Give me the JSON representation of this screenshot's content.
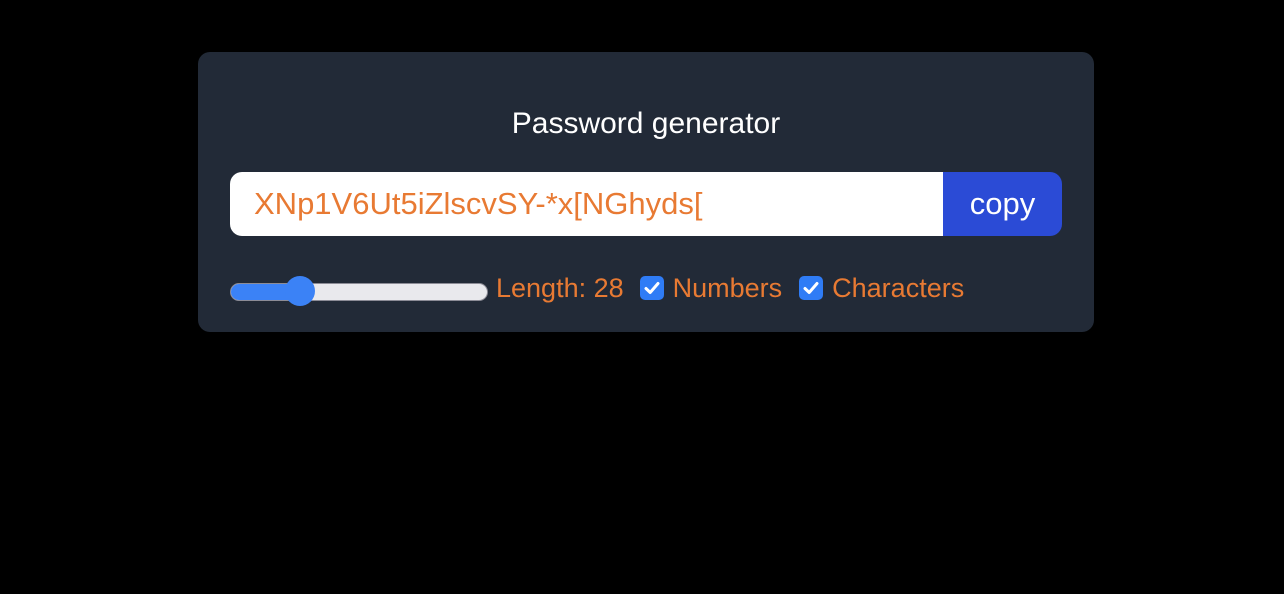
{
  "app": {
    "title": "Password generator"
  },
  "password": {
    "value": "XNp1V6Ut5iZlscvSY-*x[NGhyds["
  },
  "copy_button": {
    "label": "copy"
  },
  "length": {
    "label": "Length: 28",
    "value": 28,
    "slider_fraction": 0.27
  },
  "options": {
    "numbers": {
      "label": "Numbers",
      "checked": true
    },
    "characters": {
      "label": "Characters",
      "checked": true
    }
  },
  "colors": {
    "background": "#000000",
    "card": "#222a37",
    "accent_text": "#e87a33",
    "button": "#2b4bd6",
    "slider": "#3b82f6"
  }
}
